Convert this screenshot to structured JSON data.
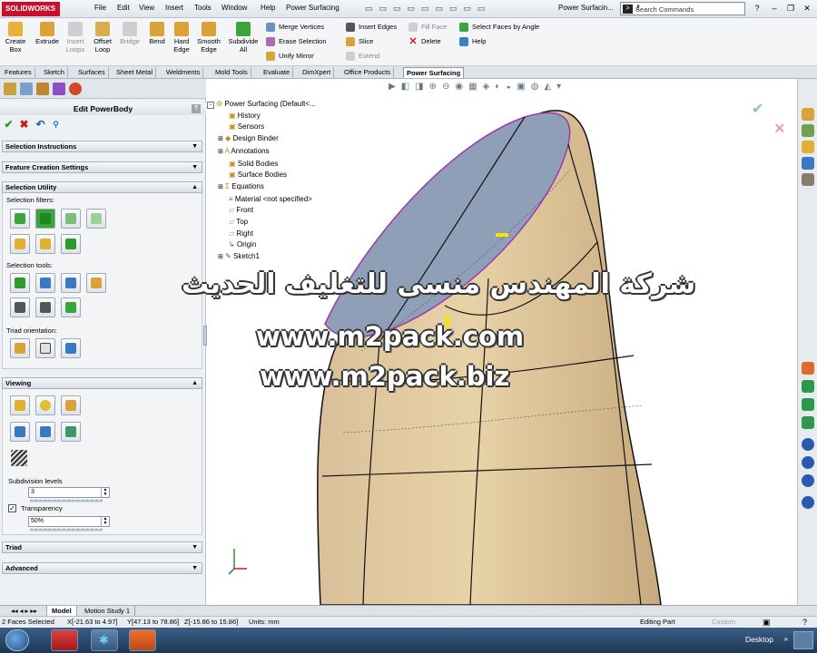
{
  "app": {
    "logo": "SOLIDWORKS",
    "menu": [
      "File",
      "Edit",
      "View",
      "Insert",
      "Tools",
      "Window",
      "Help",
      "Power Surfacing"
    ],
    "doc_title": "Power Surfacin...",
    "search_placeholder": "Search Commands"
  },
  "ribbon": {
    "big": [
      "Create Box",
      "Extrude",
      "Insert Loops",
      "Offset Loop",
      "Bridge",
      "Bend",
      "Hard Edge",
      "Smooth Edge",
      "Subdivide All"
    ],
    "col1": [
      "Merge Vertices",
      "Erase Selection",
      "Unify Mirror"
    ],
    "col2": [
      "Insert Edges",
      "Slice",
      "Extend"
    ],
    "col3": [
      "Fill Face",
      "Delete"
    ],
    "col4": [
      "Select Faces by Angle",
      "Help"
    ]
  },
  "tabs": [
    "Features",
    "Sketch",
    "Surfaces",
    "Sheet Metal",
    "Weldments",
    "Mold Tools",
    "Evaluate",
    "DimXpert",
    "Office Products",
    "Power Surfacing"
  ],
  "pm": {
    "title": "Edit PowerBody",
    "help": "?",
    "sections": {
      "sel_instr": "Selection Instructions",
      "feat_create": "Feature Creation Settings",
      "sel_util": "Selection Utility",
      "viewing": "Viewing",
      "triad": "Triad",
      "advanced": "Advanced"
    },
    "labels": {
      "filters": "Selection filters:",
      "tools": "Selection tools:",
      "triad_orient": "Triad orientation:",
      "subdiv": "Subdivision levels",
      "transparency": "Transparency"
    },
    "values": {
      "subdiv": "3",
      "transparency": "50%"
    }
  },
  "tree": {
    "root": "Power Surfacing  (Default<...",
    "items": [
      "History",
      "Sensors",
      "Design Binder",
      "Annotations",
      "Solid Bodies",
      "Surface Bodies",
      "Equations",
      "Material <not specified>",
      "Front",
      "Top",
      "Right",
      "Origin",
      "Sketch1"
    ]
  },
  "watermark": {
    "arabic": "شركة المهندس منسى للتغليف الحديث",
    "url1": "www.m2pack.com",
    "url2": "www.m2pack.biz"
  },
  "model_tabs": [
    "Model",
    "Motion Study 1"
  ],
  "status": {
    "sel": "2 Faces Selected",
    "x": "X[-21.63 to 4.97]",
    "y": "Y[47.13 to 78.86]",
    "z": "Z[-15.86 to 15.86]",
    "units": "Units: mm",
    "mode": "Editing Part",
    "custom": "Custom"
  },
  "taskbar": {
    "desktop": "Desktop"
  }
}
